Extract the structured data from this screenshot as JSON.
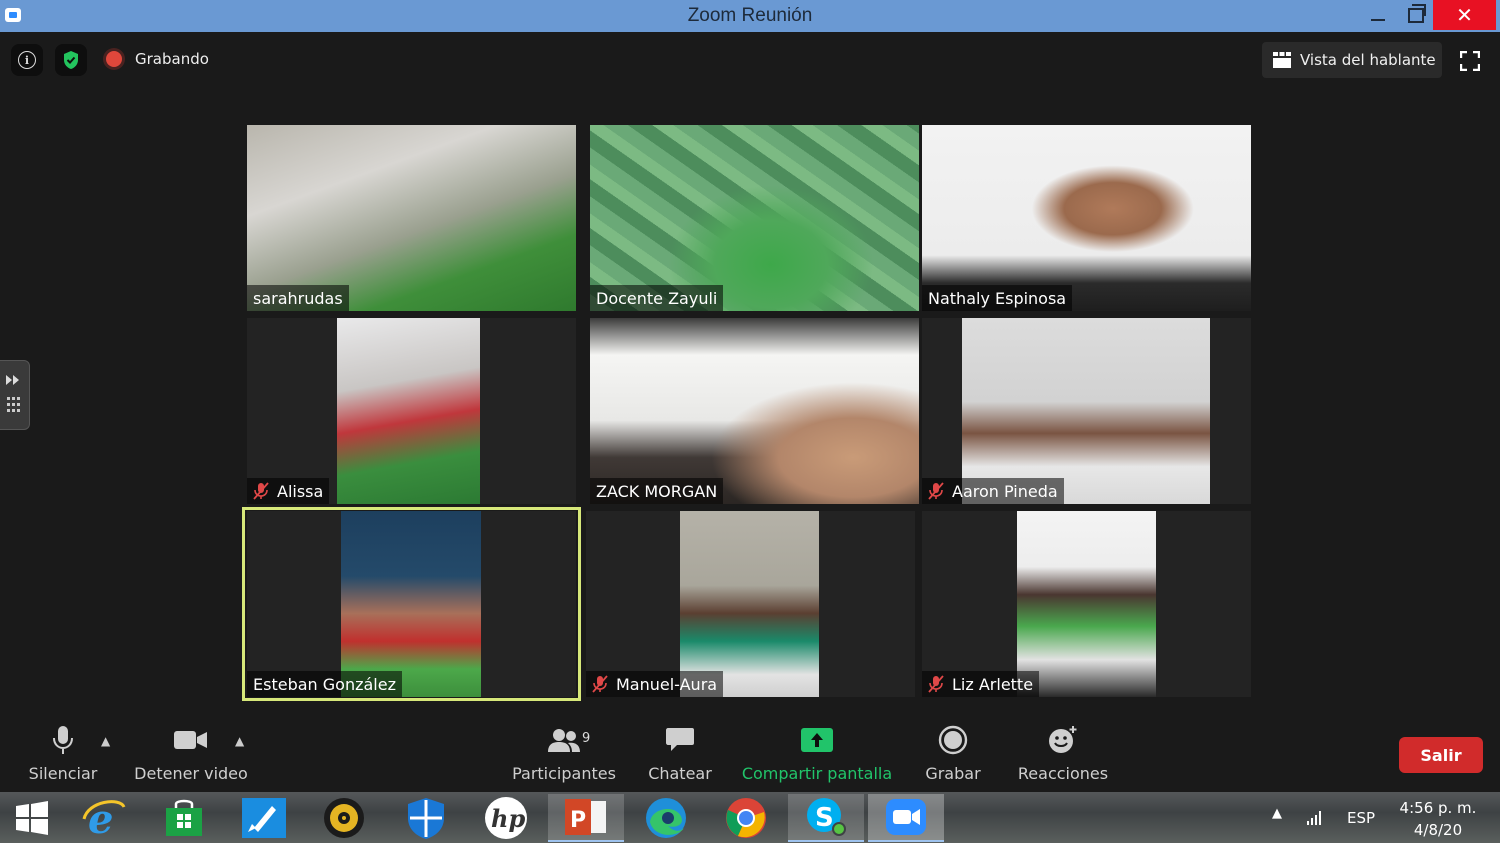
{
  "window": {
    "title": "Zoom Reunión"
  },
  "topbar": {
    "recording_label": "Grabando",
    "view_label": "Vista del hablante"
  },
  "participants": [
    {
      "name": "sarahrudas",
      "muted": false
    },
    {
      "name": "Docente Zayuli",
      "muted": false
    },
    {
      "name": "Nathaly Espinosa",
      "muted": false
    },
    {
      "name": "Alissa",
      "muted": true
    },
    {
      "name": "ZACK MORGAN",
      "muted": false
    },
    {
      "name": "Aaron Pineda",
      "muted": true
    },
    {
      "name": "Esteban González",
      "muted": false,
      "active_speaker": true
    },
    {
      "name": "Manuel-Aura",
      "muted": true
    },
    {
      "name": "Liz Arlette",
      "muted": true
    }
  ],
  "toolbar": {
    "mute_label": "Silenciar",
    "video_label": "Detener video",
    "participants_label": "Participantes",
    "participants_count": "9",
    "chat_label": "Chatear",
    "share_label": "Compartir pantalla",
    "record_label": "Grabar",
    "reactions_label": "Reacciones",
    "leave_label": "Salir"
  },
  "taskbar": {
    "language": "ESP",
    "time": "4:56 p. m.",
    "date": "4/8/20"
  },
  "colors": {
    "titlebar": "#6a99d3",
    "share_green": "#21c46a",
    "leave_red": "#d12b2b",
    "active_speaker_border": "#d7e87a",
    "mute_red": "#e04848"
  }
}
